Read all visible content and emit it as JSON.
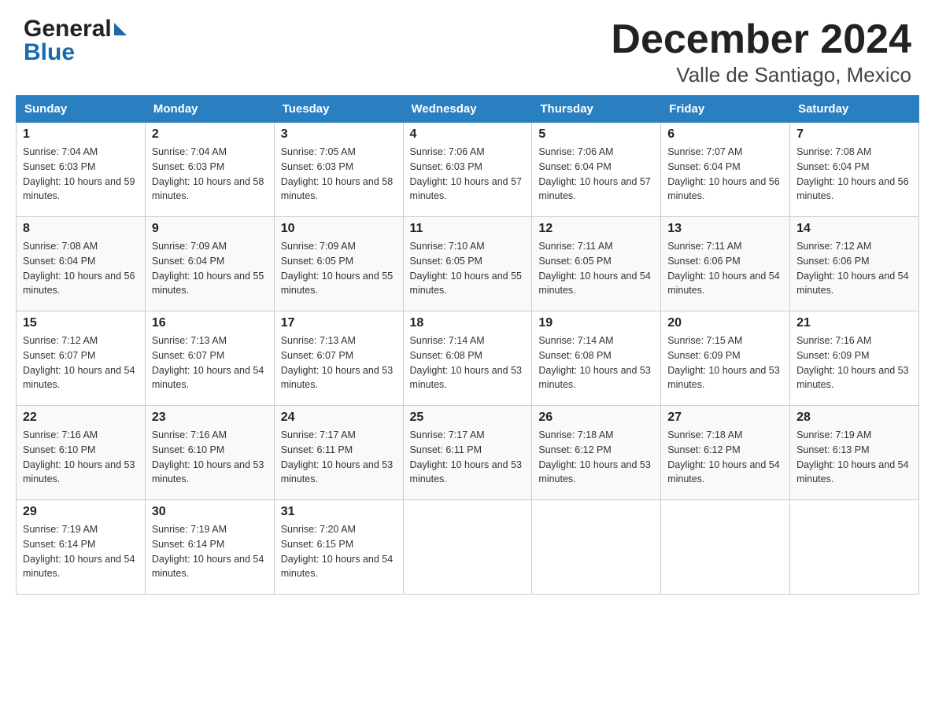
{
  "logo": {
    "line1": "General",
    "line2": "Blue"
  },
  "title": "December 2024",
  "subtitle": "Valle de Santiago, Mexico",
  "days_of_week": [
    "Sunday",
    "Monday",
    "Tuesday",
    "Wednesday",
    "Thursday",
    "Friday",
    "Saturday"
  ],
  "weeks": [
    [
      {
        "date": "1",
        "sunrise": "7:04 AM",
        "sunset": "6:03 PM",
        "daylight": "10 hours and 59 minutes."
      },
      {
        "date": "2",
        "sunrise": "7:04 AM",
        "sunset": "6:03 PM",
        "daylight": "10 hours and 58 minutes."
      },
      {
        "date": "3",
        "sunrise": "7:05 AM",
        "sunset": "6:03 PM",
        "daylight": "10 hours and 58 minutes."
      },
      {
        "date": "4",
        "sunrise": "7:06 AM",
        "sunset": "6:03 PM",
        "daylight": "10 hours and 57 minutes."
      },
      {
        "date": "5",
        "sunrise": "7:06 AM",
        "sunset": "6:04 PM",
        "daylight": "10 hours and 57 minutes."
      },
      {
        "date": "6",
        "sunrise": "7:07 AM",
        "sunset": "6:04 PM",
        "daylight": "10 hours and 56 minutes."
      },
      {
        "date": "7",
        "sunrise": "7:08 AM",
        "sunset": "6:04 PM",
        "daylight": "10 hours and 56 minutes."
      }
    ],
    [
      {
        "date": "8",
        "sunrise": "7:08 AM",
        "sunset": "6:04 PM",
        "daylight": "10 hours and 56 minutes."
      },
      {
        "date": "9",
        "sunrise": "7:09 AM",
        "sunset": "6:04 PM",
        "daylight": "10 hours and 55 minutes."
      },
      {
        "date": "10",
        "sunrise": "7:09 AM",
        "sunset": "6:05 PM",
        "daylight": "10 hours and 55 minutes."
      },
      {
        "date": "11",
        "sunrise": "7:10 AM",
        "sunset": "6:05 PM",
        "daylight": "10 hours and 55 minutes."
      },
      {
        "date": "12",
        "sunrise": "7:11 AM",
        "sunset": "6:05 PM",
        "daylight": "10 hours and 54 minutes."
      },
      {
        "date": "13",
        "sunrise": "7:11 AM",
        "sunset": "6:06 PM",
        "daylight": "10 hours and 54 minutes."
      },
      {
        "date": "14",
        "sunrise": "7:12 AM",
        "sunset": "6:06 PM",
        "daylight": "10 hours and 54 minutes."
      }
    ],
    [
      {
        "date": "15",
        "sunrise": "7:12 AM",
        "sunset": "6:07 PM",
        "daylight": "10 hours and 54 minutes."
      },
      {
        "date": "16",
        "sunrise": "7:13 AM",
        "sunset": "6:07 PM",
        "daylight": "10 hours and 54 minutes."
      },
      {
        "date": "17",
        "sunrise": "7:13 AM",
        "sunset": "6:07 PM",
        "daylight": "10 hours and 53 minutes."
      },
      {
        "date": "18",
        "sunrise": "7:14 AM",
        "sunset": "6:08 PM",
        "daylight": "10 hours and 53 minutes."
      },
      {
        "date": "19",
        "sunrise": "7:14 AM",
        "sunset": "6:08 PM",
        "daylight": "10 hours and 53 minutes."
      },
      {
        "date": "20",
        "sunrise": "7:15 AM",
        "sunset": "6:09 PM",
        "daylight": "10 hours and 53 minutes."
      },
      {
        "date": "21",
        "sunrise": "7:16 AM",
        "sunset": "6:09 PM",
        "daylight": "10 hours and 53 minutes."
      }
    ],
    [
      {
        "date": "22",
        "sunrise": "7:16 AM",
        "sunset": "6:10 PM",
        "daylight": "10 hours and 53 minutes."
      },
      {
        "date": "23",
        "sunrise": "7:16 AM",
        "sunset": "6:10 PM",
        "daylight": "10 hours and 53 minutes."
      },
      {
        "date": "24",
        "sunrise": "7:17 AM",
        "sunset": "6:11 PM",
        "daylight": "10 hours and 53 minutes."
      },
      {
        "date": "25",
        "sunrise": "7:17 AM",
        "sunset": "6:11 PM",
        "daylight": "10 hours and 53 minutes."
      },
      {
        "date": "26",
        "sunrise": "7:18 AM",
        "sunset": "6:12 PM",
        "daylight": "10 hours and 53 minutes."
      },
      {
        "date": "27",
        "sunrise": "7:18 AM",
        "sunset": "6:12 PM",
        "daylight": "10 hours and 54 minutes."
      },
      {
        "date": "28",
        "sunrise": "7:19 AM",
        "sunset": "6:13 PM",
        "daylight": "10 hours and 54 minutes."
      }
    ],
    [
      {
        "date": "29",
        "sunrise": "7:19 AM",
        "sunset": "6:14 PM",
        "daylight": "10 hours and 54 minutes."
      },
      {
        "date": "30",
        "sunrise": "7:19 AM",
        "sunset": "6:14 PM",
        "daylight": "10 hours and 54 minutes."
      },
      {
        "date": "31",
        "sunrise": "7:20 AM",
        "sunset": "6:15 PM",
        "daylight": "10 hours and 54 minutes."
      },
      null,
      null,
      null,
      null
    ]
  ],
  "labels": {
    "sunrise": "Sunrise: ",
    "sunset": "Sunset: ",
    "daylight": "Daylight: "
  }
}
